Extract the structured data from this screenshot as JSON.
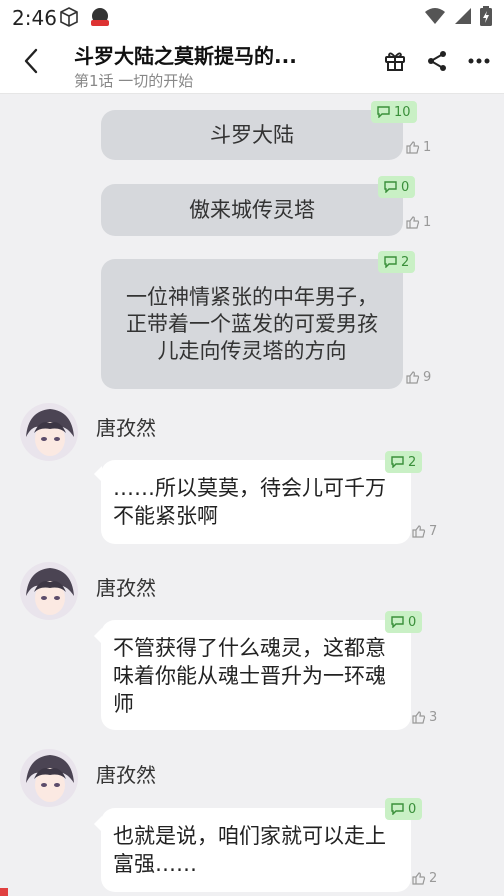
{
  "status": {
    "time": "2:46"
  },
  "header": {
    "title": "斗罗大陆之莫斯提马的...",
    "subtitle": "第1话  一切的开始"
  },
  "narrations": [
    {
      "text": "斗罗大陆",
      "comments": "10",
      "likes": "1"
    },
    {
      "text": "傲来城传灵塔",
      "comments": "0",
      "likes": "1"
    },
    {
      "text": "一位神情紧张的中年男子，正带着一个蓝发的可爱男孩儿走向传灵塔的方向",
      "comments": "2",
      "likes": "9"
    }
  ],
  "dialogues": [
    {
      "speaker": "唐孜然",
      "text": "……所以莫莫，待会儿可千万不能紧张啊",
      "comments": "2",
      "likes": "7"
    },
    {
      "speaker": "唐孜然",
      "text": "不管获得了什么魂灵，这都意味着你能从魂士晋升为一环魂师",
      "comments": "0",
      "likes": "3"
    },
    {
      "speaker": "唐孜然",
      "text": "也就是说，咱们家就可以走上富强……",
      "comments": "0",
      "likes": "2"
    }
  ],
  "icons": {
    "back": "chevron-left-icon",
    "gift": "gift-icon",
    "share": "share-icon",
    "more": "more-icon",
    "comment": "comment-icon",
    "like": "thumbs-up-icon"
  },
  "colors": {
    "badge_bg": "#c9f0c5",
    "badge_text": "#3a8f3a",
    "narration_bg": "#d6d8dc",
    "page_bg": "#f0f0f2"
  }
}
